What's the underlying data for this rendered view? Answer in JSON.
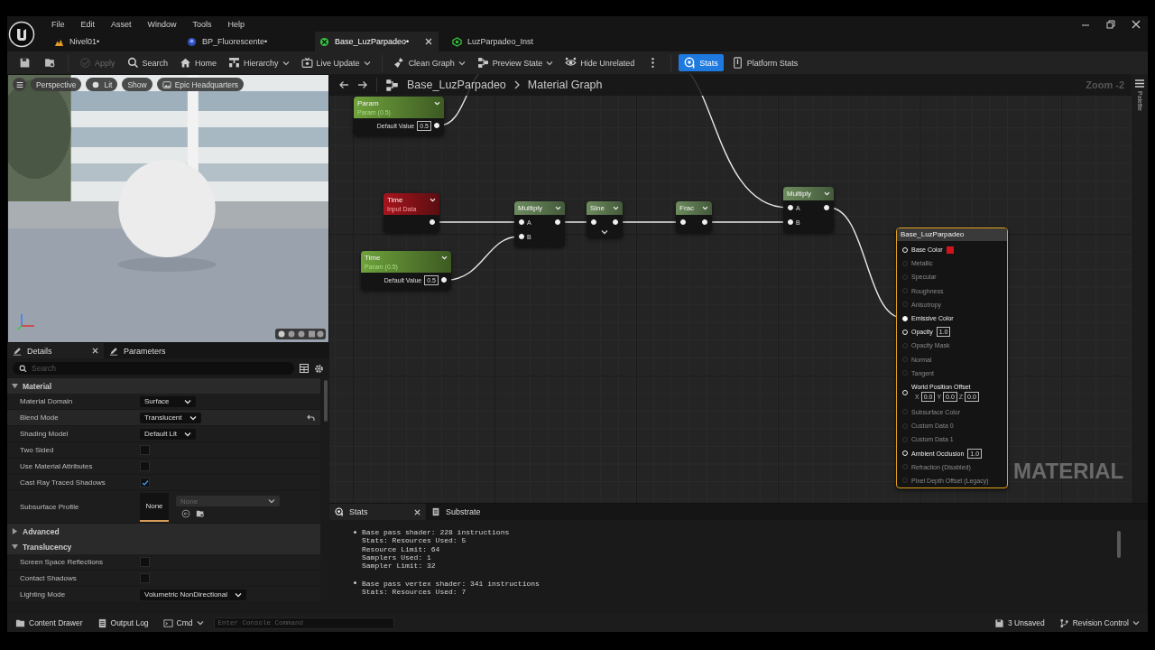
{
  "menu": [
    "File",
    "Edit",
    "Asset",
    "Window",
    "Tools",
    "Help"
  ],
  "tabs": [
    {
      "label": "Nivel01•",
      "kind": "level",
      "selected": false
    },
    {
      "label": "BP_Fluorescente•",
      "kind": "blueprint",
      "selected": false
    },
    {
      "label": "Base_LuzParpadeo•",
      "kind": "material",
      "selected": true
    },
    {
      "label": "LuzParpadeo_Inst",
      "kind": "instance",
      "selected": false
    }
  ],
  "toolbar": [
    {
      "kind": "save",
      "dropdown": false,
      "disabled": false,
      "selected": false
    },
    {
      "kind": "browse",
      "dropdown": false,
      "disabled": false,
      "selected": false
    },
    {
      "kind": "apply",
      "label": "Apply",
      "dropdown": false,
      "disabled": true,
      "selected": false
    },
    {
      "kind": "search",
      "label": "Search",
      "dropdown": false,
      "disabled": false,
      "selected": false
    },
    {
      "kind": "home",
      "label": "Home",
      "dropdown": false,
      "disabled": false,
      "selected": false
    },
    {
      "kind": "hierarchy",
      "label": "Hierarchy",
      "dropdown": true,
      "disabled": false,
      "selected": false
    },
    {
      "kind": "live",
      "label": "Live Update",
      "dropdown": true,
      "disabled": false,
      "selected": false
    },
    {
      "kind": "clean",
      "label": "Clean Graph",
      "dropdown": true,
      "disabled": false,
      "selected": false
    },
    {
      "kind": "preview",
      "label": "Preview State",
      "dropdown": true,
      "disabled": false,
      "selected": false
    },
    {
      "kind": "hide",
      "label": "Hide Unrelated",
      "dropdown": false,
      "disabled": false,
      "selected": false
    },
    {
      "kind": "more",
      "dropdown": false,
      "disabled": false,
      "selected": false
    },
    {
      "kind": "stats",
      "label": "Stats",
      "dropdown": false,
      "disabled": false,
      "selected": true
    },
    {
      "kind": "platform",
      "label": "Platform Stats",
      "dropdown": false,
      "disabled": false,
      "selected": false
    }
  ],
  "viewport": {
    "buttons": [
      {
        "kind": "menu"
      },
      {
        "kind": "text",
        "label": "Perspective"
      },
      {
        "kind": "lit",
        "label": "Lit"
      },
      {
        "kind": "text",
        "label": "Show"
      },
      {
        "kind": "scene",
        "label": "Epic Headquarters"
      }
    ]
  },
  "details": {
    "tabs": [
      {
        "label": "Details",
        "selected": true
      },
      {
        "label": "Parameters",
        "selected": false
      }
    ],
    "search": {
      "placeholder": "Search"
    },
    "sections": [
      {
        "title": "Material",
        "expanded": true,
        "rows": [
          {
            "label": "Material Domain",
            "kind": "dropdown",
            "value": "Surface",
            "modified": false
          },
          {
            "label": "Blend Mode",
            "kind": "dropdown",
            "value": "Translucent",
            "modified": true
          },
          {
            "label": "Shading Model",
            "kind": "dropdown",
            "value": "Default Lit",
            "modified": false
          },
          {
            "label": "Two Sided",
            "kind": "checkbox",
            "checked": false,
            "modified": false
          },
          {
            "label": "Use Material Attributes",
            "kind": "checkbox",
            "checked": false,
            "modified": false
          },
          {
            "label": "Cast Ray Traced Shadows",
            "kind": "checkbox",
            "checked": true,
            "modified": false
          },
          {
            "label": "Subsurface Profile",
            "kind": "asset",
            "thumbnail": "None",
            "value": "None",
            "modified": false
          }
        ]
      },
      {
        "title": "Advanced",
        "expanded": false
      },
      {
        "title": "Translucency",
        "expanded": true,
        "rows": [
          {
            "label": "Screen Space Reflections",
            "kind": "checkbox",
            "checked": false,
            "modified": false
          },
          {
            "label": "Contact Shadows",
            "kind": "checkbox",
            "checked": false,
            "modified": false
          },
          {
            "label": "Lighting Mode",
            "kind": "dropdown",
            "value": "Volumetric NonDirectional",
            "modified": false
          }
        ]
      }
    ]
  },
  "graph": {
    "breadcrumb": [
      "Base_LuzParpadeo",
      "Material Graph"
    ],
    "zoom": "Zoom -2",
    "palette": "Palette",
    "watermark": "MATERIAL",
    "nodes": [
      {
        "kind": "param",
        "title": "Param",
        "subtitle": "Param (0.5)",
        "default_label": "Default Value",
        "default_value": "0.5"
      },
      {
        "kind": "input",
        "title": "Time",
        "subtitle": "Input Data"
      },
      {
        "kind": "param",
        "title": "Time",
        "subtitle": "Param (0.5)",
        "default_label": "Default Value",
        "default_value": "0.5"
      },
      {
        "kind": "math",
        "title": "Multiply",
        "inputs": [
          "A",
          "B"
        ],
        "advanced": false
      },
      {
        "kind": "math",
        "title": "Sine",
        "advanced": true
      },
      {
        "kind": "math",
        "title": "Frac",
        "advanced": false
      },
      {
        "kind": "math",
        "title": "Multiply",
        "inputs": [
          "A",
          "B"
        ],
        "advanced": false
      }
    ],
    "output": {
      "title": "Base_LuzParpadeo",
      "pins": [
        {
          "label": "Base Color",
          "kind": "color",
          "color": "#d0141c",
          "enabled": true,
          "connected": false
        },
        {
          "label": "Metallic",
          "kind": "plain",
          "enabled": false,
          "connected": false
        },
        {
          "label": "Specular",
          "kind": "plain",
          "enabled": false,
          "connected": false
        },
        {
          "label": "Roughness",
          "kind": "plain",
          "enabled": false,
          "connected": false
        },
        {
          "label": "Anisotropy",
          "kind": "plain",
          "enabled": false,
          "connected": false
        },
        {
          "label": "Emissive Color",
          "kind": "plain",
          "enabled": true,
          "connected": true
        },
        {
          "label": "Opacity",
          "kind": "value",
          "value": "1.0",
          "enabled": true,
          "connected": false
        },
        {
          "label": "Opacity Mask",
          "kind": "plain",
          "enabled": false,
          "connected": false
        },
        {
          "label": "Normal",
          "kind": "plain",
          "enabled": false,
          "connected": false
        },
        {
          "label": "Tangent",
          "kind": "plain",
          "enabled": false,
          "connected": false
        },
        {
          "label": "World Position Offset",
          "kind": "vector",
          "components": [
            {
              "axis": "X",
              "value": "0.0"
            },
            {
              "axis": "Y",
              "value": "0.0"
            },
            {
              "axis": "Z",
              "value": "0.0"
            }
          ],
          "enabled": true,
          "connected": false
        },
        {
          "label": "Subsurface Color",
          "kind": "plain",
          "enabled": false,
          "connected": false
        },
        {
          "label": "Custom Data 0",
          "kind": "plain",
          "enabled": false,
          "connected": false
        },
        {
          "label": "Custom Data 1",
          "kind": "plain",
          "enabled": false,
          "connected": false
        },
        {
          "label": "Ambient Occlusion",
          "kind": "value",
          "value": "1.0",
          "enabled": true,
          "connected": false
        },
        {
          "label": "Refraction (Disabled)",
          "kind": "plain",
          "enabled": false,
          "connected": false
        },
        {
          "label": "Pixel Depth Offset (Legacy)",
          "kind": "plain",
          "enabled": false,
          "connected": false
        }
      ]
    }
  },
  "stats": {
    "tabs": [
      {
        "label": "Stats",
        "selected": true
      },
      {
        "label": "Substrate",
        "selected": false
      }
    ],
    "entries": [
      {
        "lines": [
          "Base pass shader: 228 instructions",
          "Stats: Resources Used: 5",
          "Resource Limit: 64",
          "Samplers Used: 1",
          "Sampler Limit: 32"
        ]
      },
      {
        "lines": [
          "Base pass vertex shader: 341 instructions",
          "Stats: Resources Used: 7"
        ]
      }
    ]
  },
  "status_bar": {
    "left": [
      {
        "kind": "drawer",
        "label": "Content Drawer",
        "dropdown": false
      },
      {
        "kind": "log",
        "label": "Output Log",
        "dropdown": false
      },
      {
        "kind": "cmd",
        "label": "Cmd",
        "dropdown": true
      }
    ],
    "console": {
      "placeholder": "Enter Console Command"
    },
    "right": [
      {
        "kind": "unsaved",
        "label": "3 Unsaved",
        "dropdown": false
      },
      {
        "kind": "revision",
        "label": "Revision Control",
        "dropdown": true
      }
    ]
  }
}
